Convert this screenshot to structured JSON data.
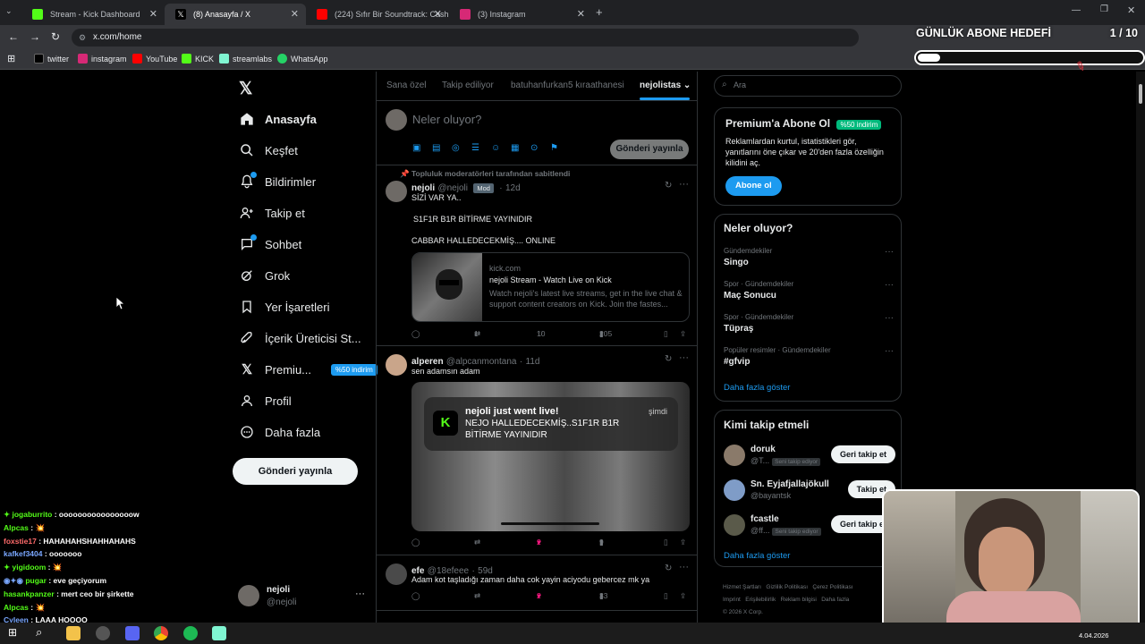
{
  "browser": {
    "tabs": [
      {
        "title": "Stream - Kick Dashboard",
        "color": "#53fc18"
      },
      {
        "title": "(8) Anasayfa / X",
        "color": "#000000"
      },
      {
        "title": "(224) Sıfır Bir Soundtrack: Cash",
        "color": "#ff0000"
      },
      {
        "title": "(3) Instagram",
        "color": "#d62976"
      }
    ],
    "url": "x.com/home",
    "bookmarks": [
      {
        "label": "twitter",
        "color": "#000000"
      },
      {
        "label": "instagram",
        "color": "#d62976"
      },
      {
        "label": "YouTube",
        "color": "#ff0000"
      },
      {
        "label": "KICK",
        "color": "#53fc18"
      },
      {
        "label": "streamlabs",
        "color": "#80f5d2"
      },
      {
        "label": "WhatsApp",
        "color": "#25d366"
      }
    ]
  },
  "goal": {
    "title": "GÜNLÜK ABONE HEDEFİ",
    "progress_text": "1 / 10",
    "progress": 0.1
  },
  "sidebar": {
    "items": [
      {
        "label": "Anasayfa",
        "icon": "home-icon",
        "bold": true
      },
      {
        "label": "Keşfet",
        "icon": "search-icon"
      },
      {
        "label": "Bildirimler",
        "icon": "bell-icon"
      },
      {
        "label": "Takip et",
        "icon": "add-person-icon"
      },
      {
        "label": "Sohbet",
        "icon": "chat-icon"
      },
      {
        "label": "Grok",
        "icon": "grok-icon"
      },
      {
        "label": "Yer İşaretleri",
        "icon": "bookmark-icon"
      },
      {
        "label": "İçerik Üreticisi St...",
        "icon": "rocket-icon"
      },
      {
        "label": "Premiu...",
        "icon": "x-logo-icon",
        "badge": "%50 indirim"
      },
      {
        "label": "Profil",
        "icon": "person-icon"
      },
      {
        "label": "Daha fazla",
        "icon": "more-circle-icon"
      }
    ],
    "post_button": "Gönderi yayınla",
    "account": {
      "name": "nejoli",
      "handle": "@nejoli"
    }
  },
  "feed": {
    "tabs": [
      "Sana özel",
      "Takip ediliyor",
      "batuhanfurkan5 kıraathanesi",
      "nejolistas"
    ],
    "compose_placeholder": "Neler oluyor?",
    "compose_button": "Gönderi yayınla",
    "pinned_label": "Topluluk moderatörleri tarafından sabitlendi",
    "tweets": [
      {
        "name": "nejoli",
        "handle": "@nejoli",
        "badge": "Mod",
        "time": "12d",
        "lines": [
          "SİZİ VAR YA..",
          "",
          "S1F1R B1R BİTİRME YAYINIDIR",
          "",
          "CABBAR HALLEDECEKMİŞ.... ONLINE"
        ],
        "link_card": {
          "domain": "kick.com",
          "title": "nejoli Stream - Watch Live on Kick",
          "desc": "Watch nejoli's latest live streams, get in the live chat & support content creators on Kick. Join the fastes..."
        },
        "stats": {
          "replies": "",
          "reposts": "1",
          "likes": "10",
          "views": "205"
        }
      },
      {
        "name": "alperen",
        "handle": "@alpcanmontana",
        "time": "11d",
        "lines": [
          "sen adamsın adam"
        ],
        "notification": {
          "title": "nejoli just went live!",
          "body": "NEJO HALLEDECEKMİŞ..S1F1R B1R BİTİRME YAYINIDIR",
          "time": "şimdi"
        },
        "stats": {
          "replies": "",
          "reposts": "",
          "likes": "2",
          "views": "9"
        }
      },
      {
        "name": "efe",
        "handle": "@18efeee",
        "time": "59d",
        "lines": [
          "Adam kot taşladığı zaman daha cok yayin aciyodu gebercez mk ya"
        ],
        "stats": {
          "replies": "",
          "reposts": "",
          "likes": "2",
          "views": "33"
        }
      }
    ]
  },
  "right": {
    "search_placeholder": "Ara",
    "premium": {
      "title": "Premium'a Abone Ol",
      "badge": "%50 indirim",
      "body": "Reklamlardan kurtul, istatistikleri gör, yanıtlarını öne çıkar ve 20'den fazla özelliğin kilidini aç.",
      "button": "Abone ol"
    },
    "trends_title": "Neler oluyor?",
    "trends": [
      {
        "category": "Gündemdekiler",
        "name": "Singo"
      },
      {
        "category": "Spor · Gündemdekiler",
        "name": "Maç Sonucu"
      },
      {
        "category": "Spor · Gündemdekiler",
        "name": "Tüpraş"
      },
      {
        "category": "Popüler resimler · Gündemdekiler",
        "name": "#gfvip"
      }
    ],
    "show_more": "Daha fazla göster",
    "who_to_follow_title": "Kimi takip etmeli",
    "follow": [
      {
        "name": "doruk",
        "handle": "@T...",
        "tag": "Seni takip ediyor",
        "button": "Geri takip et"
      },
      {
        "name": "Sn. Eyjafjallajökull",
        "handle": "@bayantsk",
        "tag": "",
        "button": "Takip et"
      },
      {
        "name": "fcastle",
        "handle": "@ff...",
        "tag": "Seni takip ediyor",
        "button": "Geri takip et"
      }
    ],
    "follow_more": "Daha fazla göster",
    "footer": [
      "Hizmet Şartları",
      "Gizlilik Politikası",
      "Çerez Politikası",
      "Imprint",
      "Erişilebilirlik",
      "Reklam bilgisi",
      "Daha fazla",
      "© 2026 X Corp."
    ]
  },
  "chat": [
    {
      "user": "jogaburrito",
      "color": "#53fc18",
      "msg": "oooooooooooooooow"
    },
    {
      "user": "Alpcas",
      "color": "#53fc18",
      "msg": "💥"
    },
    {
      "user": "foxstie17",
      "color": "#ff6b6b",
      "msg": "HAHAHAHSHAHHAHAHS"
    },
    {
      "user": "kafkef3404",
      "color": "#7aa7ff",
      "msg": "ooooooo"
    },
    {
      "user": "yigidoom",
      "color": "#53fc18",
      "msg": "💥"
    },
    {
      "user": "pugar",
      "color": "#53fc18",
      "msg": "eve geçiyorum"
    },
    {
      "user": "hasankpanzer",
      "color": "#53fc18",
      "msg": "mert ceo bir şirkette"
    },
    {
      "user": "Alpcas",
      "color": "#53fc18",
      "msg": "💥"
    },
    {
      "user": "Cyleen",
      "color": "#7aa7ff",
      "msg": "LAAA HOOOO"
    }
  ],
  "taskbar": {
    "date": "4.04.2026"
  }
}
